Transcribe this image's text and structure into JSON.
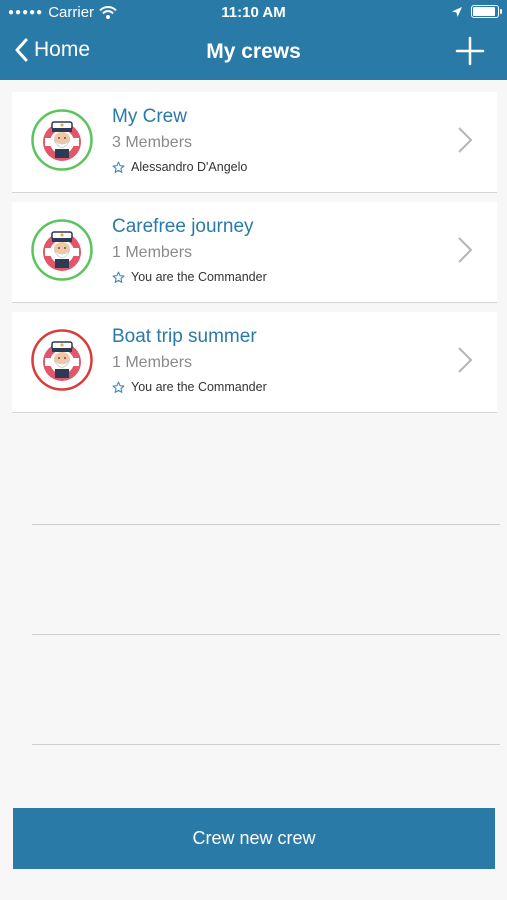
{
  "status_bar": {
    "carrier": "Carrier",
    "time": "11:10 AM",
    "icons": [
      "signal-dots-icon",
      "wifi-icon",
      "location-arrow-icon",
      "battery-icon"
    ]
  },
  "nav": {
    "back_label": "Home",
    "title": "My crews",
    "add_icon": "plus-icon"
  },
  "crews": [
    {
      "name": "My Crew",
      "members": "3 Members",
      "role": "Alessandro D'Angelo",
      "ring_color": "#5cc45c"
    },
    {
      "name": "Carefree journey",
      "members": "1 Members",
      "role": "You are the Commander",
      "ring_color": "#5cc45c"
    },
    {
      "name": "Boat trip summer",
      "members": "1 Members",
      "role": "You are the Commander",
      "ring_color": "#d83c3c"
    }
  ],
  "cta_label": "Crew new crew",
  "colors": {
    "accent": "#2a7aa8",
    "background": "#f7f7f7"
  }
}
